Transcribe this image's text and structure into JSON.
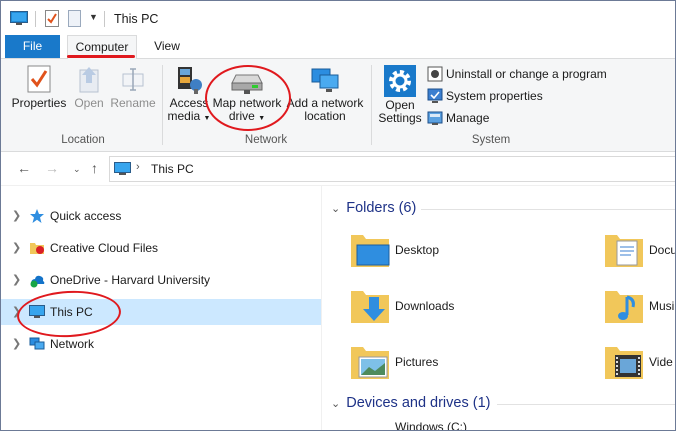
{
  "window": {
    "title": "This PC"
  },
  "ribbon_tabs": {
    "file": "File",
    "computer": "Computer",
    "view": "View"
  },
  "ribbon": {
    "location": {
      "group_label": "Location",
      "properties": "Properties",
      "open": "Open",
      "rename": "Rename"
    },
    "network": {
      "group_label": "Network",
      "access_media_1": "Access",
      "access_media_2": "media",
      "map_drive_1": "Map network",
      "map_drive_2": "drive",
      "add_location_1": "Add a network",
      "add_location_2": "location"
    },
    "system": {
      "group_label": "System",
      "open_settings_1": "Open",
      "open_settings_2": "Settings",
      "uninstall": "Uninstall or change a program",
      "system_properties": "System properties",
      "manage": "Manage"
    }
  },
  "address_bar": {
    "path": "This PC"
  },
  "nav_pane": {
    "items": [
      {
        "label": "Quick access"
      },
      {
        "label": "Creative Cloud Files"
      },
      {
        "label": "OneDrive - Harvard University"
      },
      {
        "label": "This PC"
      },
      {
        "label": "Network"
      }
    ]
  },
  "content": {
    "folders_header": "Folders (6)",
    "folders": [
      {
        "label": "Desktop"
      },
      {
        "label": "Docu"
      },
      {
        "label": "Downloads"
      },
      {
        "label": "Musi"
      },
      {
        "label": "Pictures"
      },
      {
        "label": "Vide"
      }
    ],
    "devices_header": "Devices and drives (1)",
    "drive_label": "Windows (C:)"
  },
  "colors": {
    "accent": "#1979ca",
    "selection": "#cce8ff",
    "annotation": "#e0191e",
    "section_header": "#1e3287",
    "folder_yellow": "#f1c75a"
  }
}
